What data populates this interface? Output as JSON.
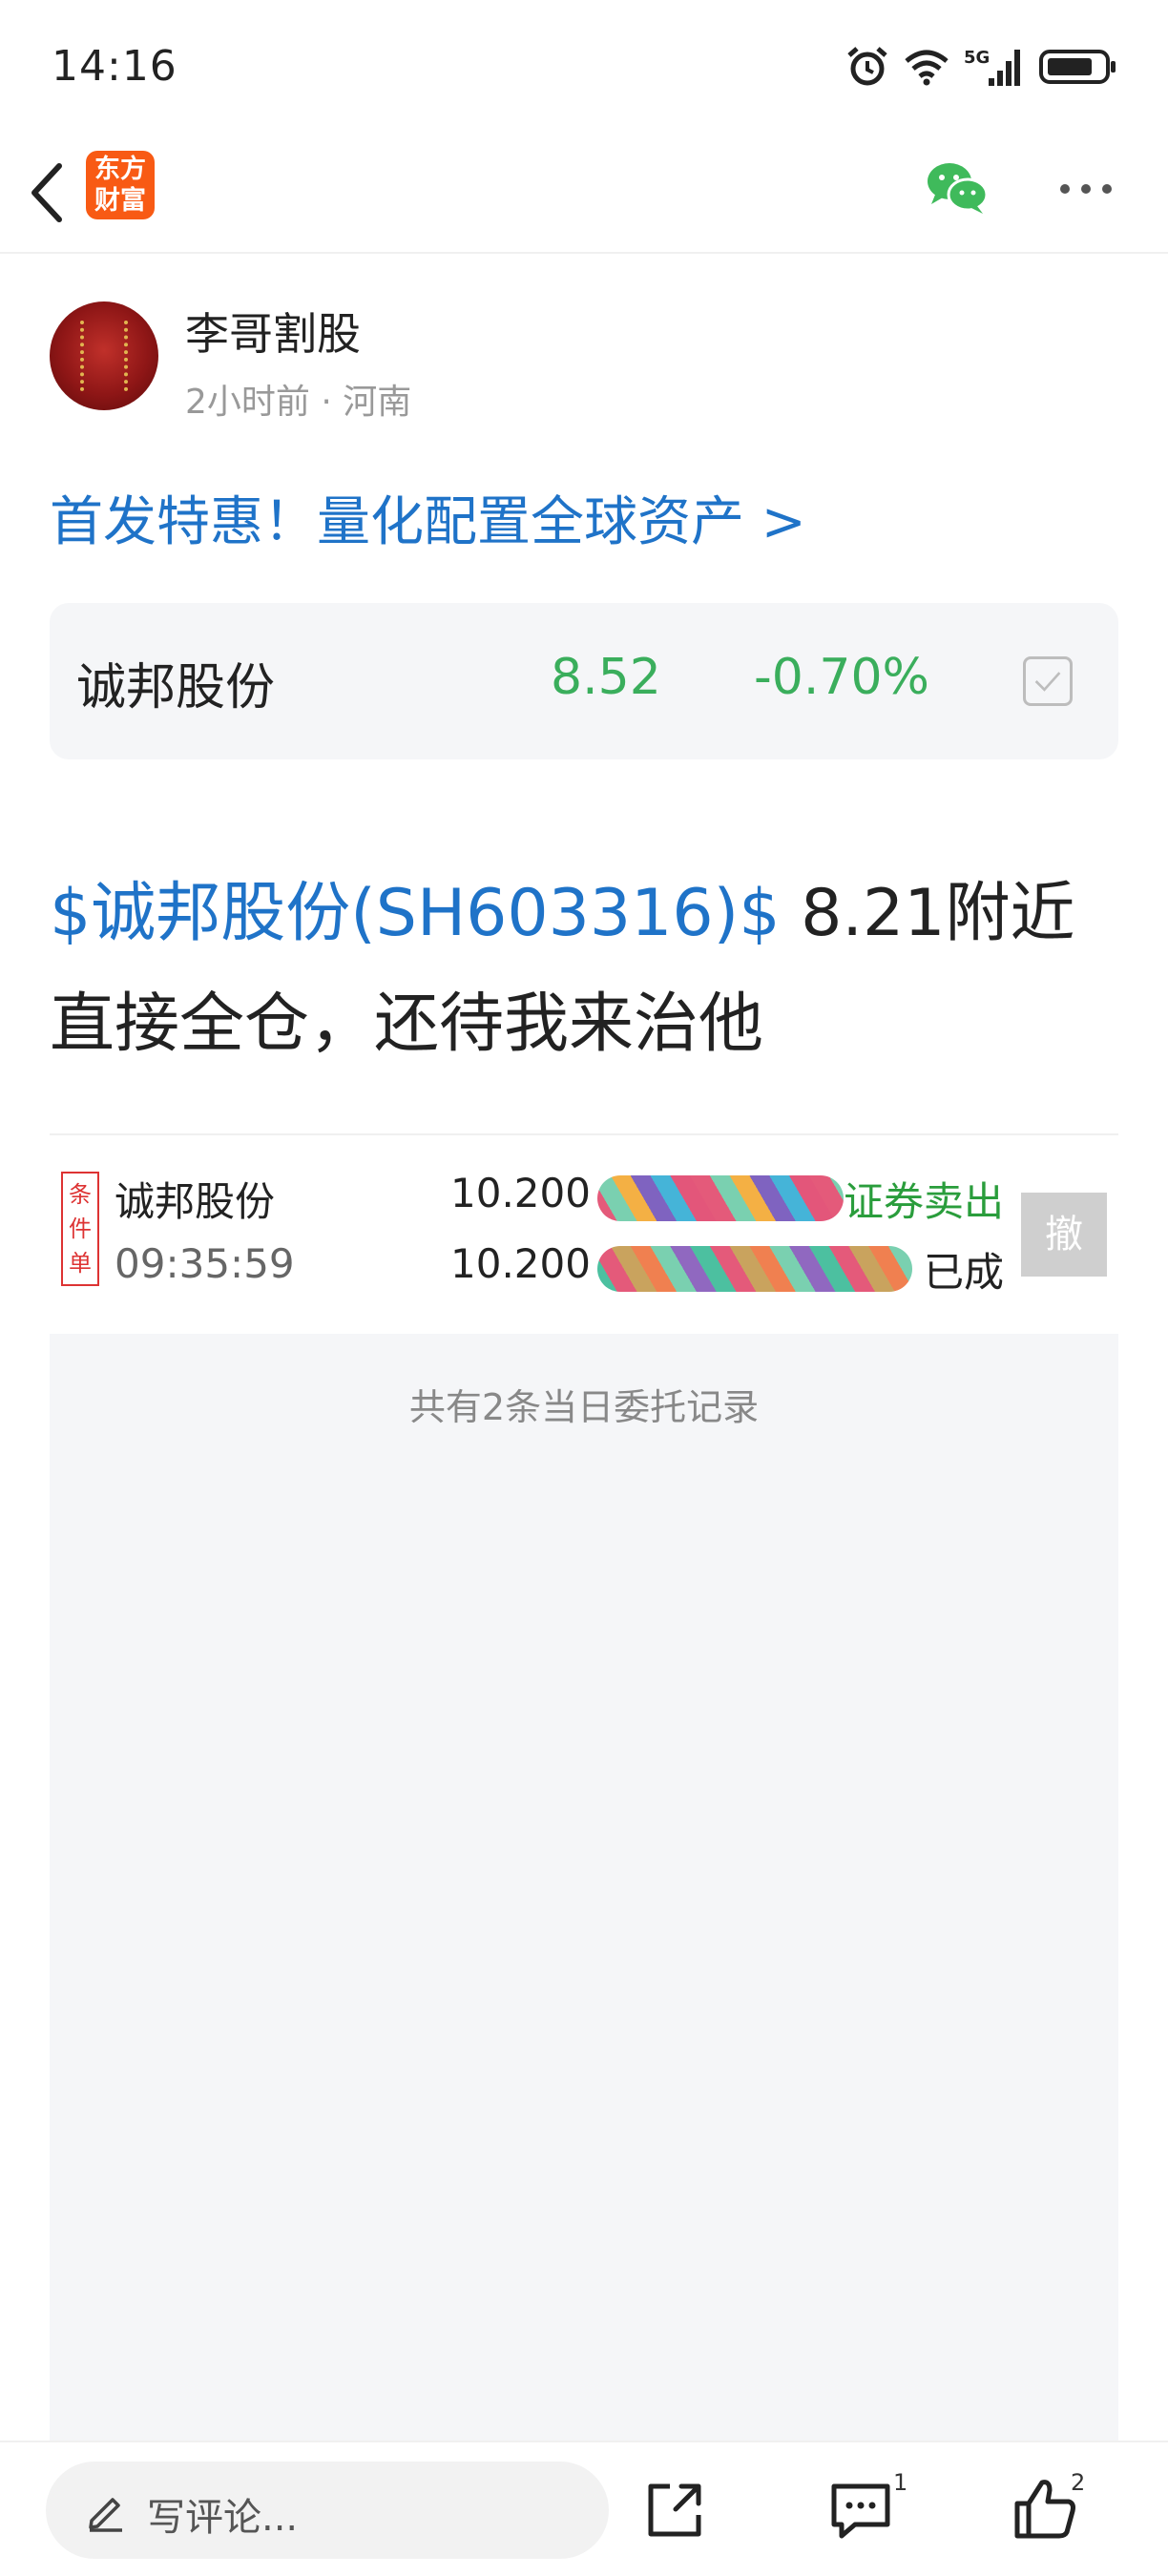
{
  "status_bar": {
    "time": "14:16",
    "icons": [
      "alarm-icon",
      "wifi-icon",
      "5g-signal-icon",
      "battery-icon"
    ]
  },
  "nav": {
    "back_icon": "chevron-left-icon",
    "app_logo_line1": "东方",
    "app_logo_line2": "财富",
    "wechat_icon": "wechat-icon",
    "more_icon": "more-horizontal-icon",
    "brand_color": "#f85a14",
    "wechat_color": "#3fba5b"
  },
  "author": {
    "name": "李哥割股",
    "time": "2小时前",
    "separator": "·",
    "location": "河南"
  },
  "promo": {
    "text": "首发特惠！量化配置全球资产 >",
    "color": "#1f73c8"
  },
  "stock_card": {
    "name": "诚邦股份",
    "price": "8.52",
    "change": "-0.70%",
    "color": "#3aae5c",
    "add_icon": "checkbox-icon"
  },
  "post": {
    "stock_tag": "$诚邦股份(SH603316)$",
    "text_line1": " 8.21附近",
    "text_line2": "直接全仓，还待我来治他"
  },
  "order": {
    "badge_chars": [
      "条",
      "件",
      "单"
    ],
    "stock_name": "诚邦股份",
    "time": "09:35:59",
    "price1": "10.200",
    "price2": "10.200",
    "action": "证券卖出",
    "status": "已成",
    "cancel_label": "撤",
    "action_color": "#2a9d3c"
  },
  "records": {
    "text": "共有2条当日委托记录"
  },
  "bottom_bar": {
    "comment_placeholder": "写评论...",
    "comment_count": "1",
    "like_count": "2",
    "icons": [
      "pencil-icon",
      "share-icon",
      "comment-icon",
      "thumbs-up-icon"
    ]
  }
}
